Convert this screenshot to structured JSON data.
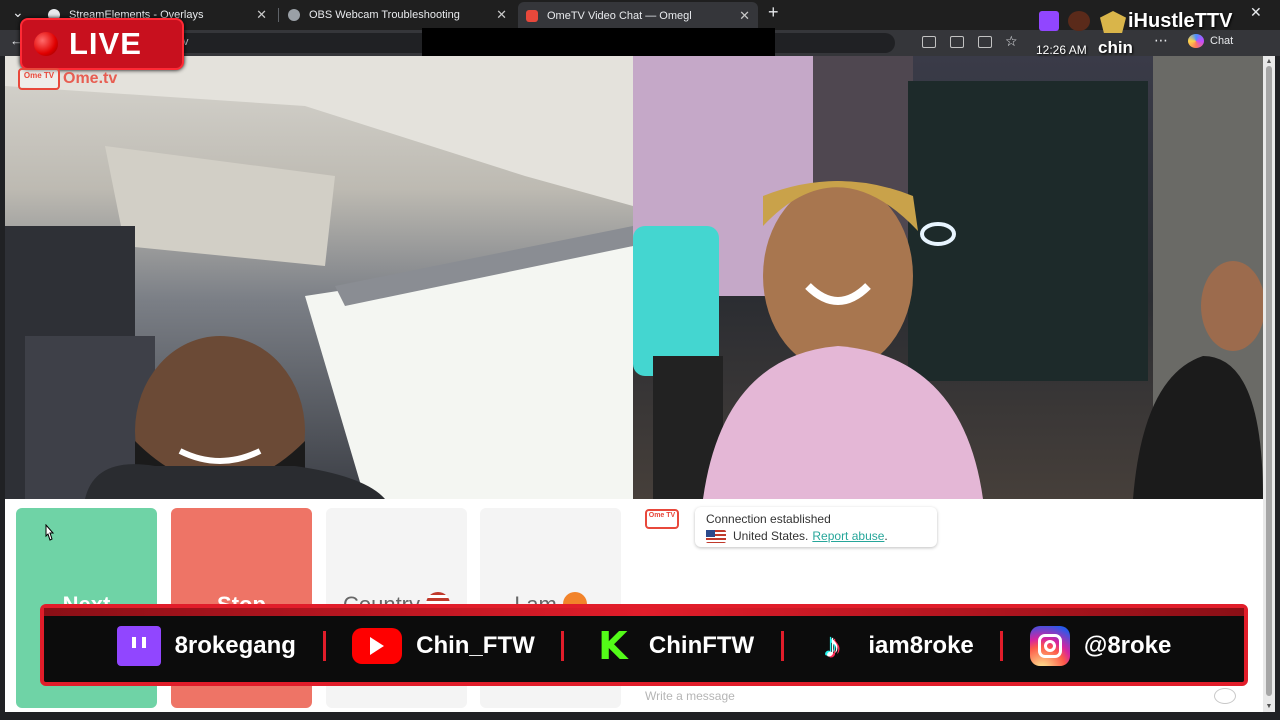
{
  "browser": {
    "tabs": [
      {
        "title": "StreamElements - Overlays",
        "active": false
      },
      {
        "title": "OBS Webcam Troubleshooting",
        "active": false
      },
      {
        "title": "OmeTV Video Chat — Omegl",
        "active": true
      }
    ],
    "new_tab": "+",
    "url_fragment": "tv",
    "chat_button": "Chat"
  },
  "overlay": {
    "live_label": "LIVE",
    "streamer_name": "iHustleTTV",
    "clock": "12:26 AM",
    "sub_name": "chin"
  },
  "site": {
    "logo_box": "Ome TV",
    "logo_name": "Ome.tv"
  },
  "controls": {
    "next": "Next",
    "stop": "Stop",
    "country": "Country",
    "gender": "I am"
  },
  "chat": {
    "logo": "Ome TV",
    "status": "Connection established",
    "country": "United States.",
    "report": "Report abuse",
    "report_suffix": ".",
    "input_placeholder": "Write a message"
  },
  "socials": [
    {
      "icon": "twitch-icon",
      "handle": "8rokegang"
    },
    {
      "icon": "youtube-icon",
      "handle": "Chin_FTW"
    },
    {
      "icon": "kick-icon",
      "handle": "ChinFTW"
    },
    {
      "icon": "tiktok-icon",
      "handle": "iam8roke"
    },
    {
      "icon": "instagram-icon",
      "handle": "@8roke"
    }
  ],
  "colors": {
    "next": "#6fd3a6",
    "stop": "#ee7466",
    "accent": "#e11d2a",
    "twitch": "#9146ff"
  }
}
